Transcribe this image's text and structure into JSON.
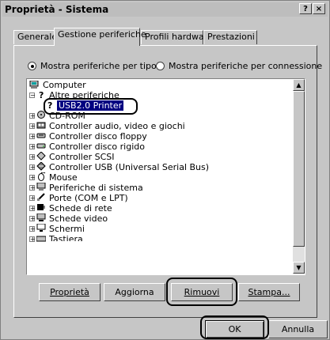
{
  "window": {
    "title": "Proprietà - Sistema",
    "help_btn": "?",
    "close_btn": "×"
  },
  "tabs": [
    "Generale",
    "Gestione periferiche",
    "Profili hardware",
    "Prestazioni"
  ],
  "radios": [
    {
      "label": "Mostra periferiche per tipo",
      "accel": "M",
      "checked": true
    },
    {
      "label": "Mostra periferiche per connessione",
      "accel": "o",
      "checked": false
    }
  ],
  "tree": {
    "root": "Computer",
    "items": [
      "Altre periferiche",
      "USB2.0 Printer",
      "CD-ROM",
      "Controller audio, video e giochi",
      "Controller disco floppy",
      "Controller disco rigido",
      "Controller SCSI",
      "Controller USB (Universal Serial Bus)",
      "Mouse",
      "Periferiche di sistema",
      "Porte (COM e LPT)",
      "Schede di rete",
      "Schede video",
      "Schermi",
      "Tastiera"
    ]
  },
  "buttons": {
    "proprieta": "Proprietà",
    "aggiorna": "Aggiorna",
    "rimuovi": "Rimuovi",
    "stampa": "Stampa...",
    "ok": "OK",
    "annulla": "Annulla"
  }
}
